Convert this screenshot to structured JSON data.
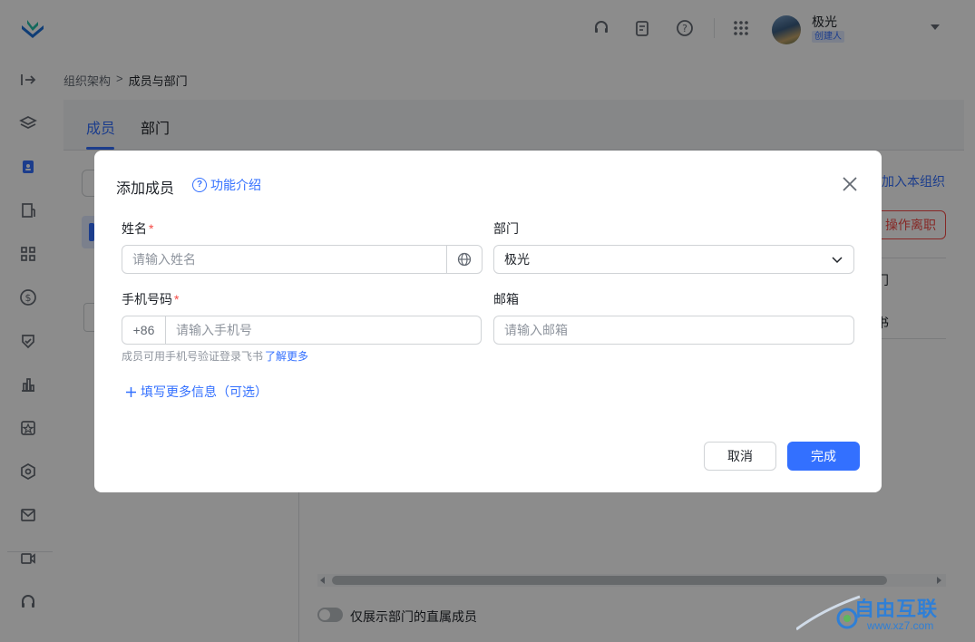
{
  "header": {
    "user_name": "极光",
    "user_role": "创建人",
    "icons": [
      "headset-icon",
      "clipboard-icon",
      "help-icon",
      "apps-grid-icon"
    ]
  },
  "sidebar": {
    "icons": [
      "expand-icon",
      "layers-icon",
      "contacts-icon",
      "building-icon",
      "grid-icon",
      "dollar-icon",
      "shield-icon",
      "chart-icon",
      "badge-icon",
      "settings-icon",
      "mail-icon",
      "video-icon",
      "headset-icon"
    ]
  },
  "breadcrumb": {
    "parent": "组织架构",
    "separator": ">",
    "current": "成员与部门"
  },
  "tabs": [
    {
      "label": "成员"
    },
    {
      "label": "部门"
    }
  ],
  "page": {
    "join_org_link": "加入本组织",
    "resign_button": "操作离职",
    "table_cell_1": "门",
    "table_cell_2": "书",
    "direct_members_toggle_label": "仅展示部门的直属成员"
  },
  "watermark": {
    "text": "自由互联",
    "url": "www.xz7.com"
  },
  "modal": {
    "title": "添加成员",
    "intro_link": "功能介绍",
    "name_label": "姓名",
    "name_placeholder": "请输入姓名",
    "required_mark": "*",
    "dept_label": "部门",
    "dept_value": "极光",
    "phone_label": "手机号码",
    "phone_code": "+86",
    "phone_placeholder": "请输入手机号",
    "email_label": "邮箱",
    "email_placeholder": "请输入邮箱",
    "hint_text": "成员可用手机号验证登录飞书",
    "hint_link": "了解更多",
    "more_info": "填写更多信息（可选）",
    "cancel_button": "取消",
    "confirm_button": "完成"
  },
  "colors": {
    "accent": "#3370ff",
    "danger": "#f54a45"
  }
}
